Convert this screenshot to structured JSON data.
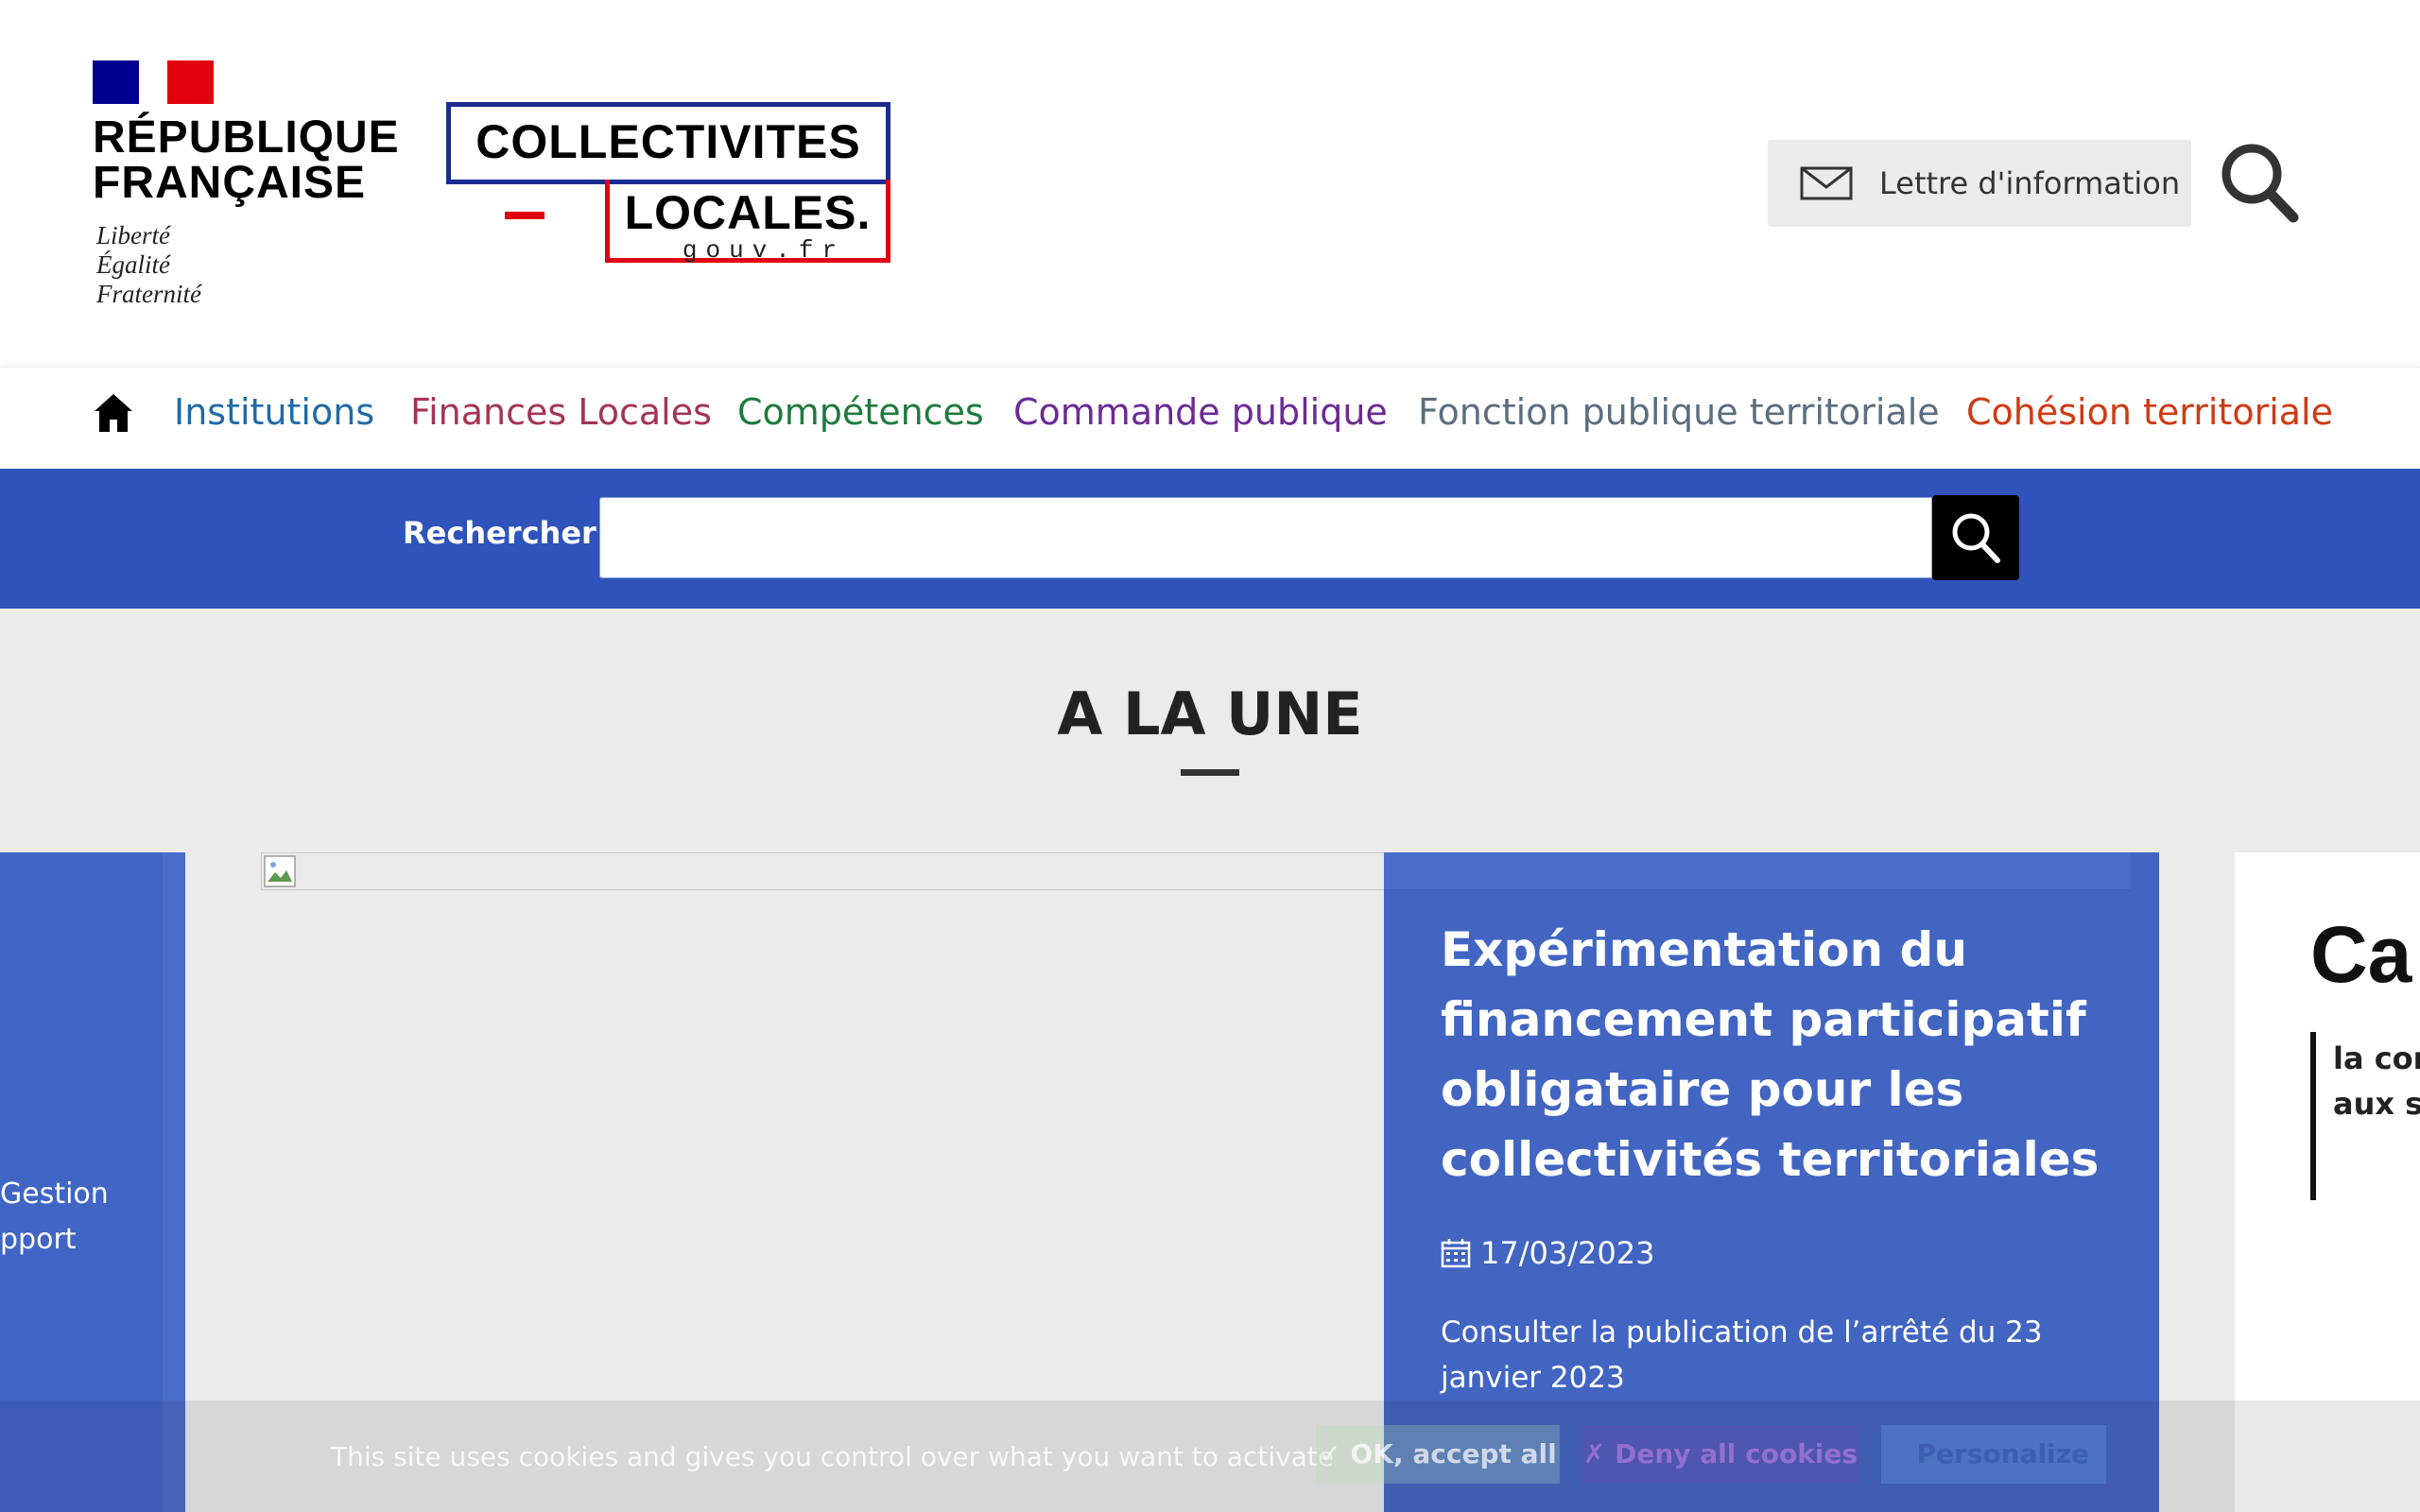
{
  "header": {
    "republique": {
      "name_line1": "RÉPUBLIQUE",
      "name_line2": "FRANÇAISE",
      "motto": [
        "Liberté",
        "Égalité",
        "Fraternité"
      ],
      "flag_colors": [
        "#000091",
        "#ffffff",
        "#e1000f"
      ]
    },
    "site_logo": {
      "line1": "COLLECTIVITES",
      "line2": "LOCALES.",
      "url": "gouv.fr",
      "colors": {
        "blue": "#1b2b8f",
        "red": "#e1000f"
      }
    },
    "newsletter_label": "Lettre d'information",
    "newsletter_icon": "envelope-icon",
    "search_icon": "search-icon"
  },
  "nav": {
    "home_icon": "home-icon",
    "items": [
      {
        "label": "Institutions",
        "color": "#1f6aa8"
      },
      {
        "label": "Finances Locales",
        "color": "#a43454"
      },
      {
        "label": "Compétences",
        "color": "#1e7a3e"
      },
      {
        "label": "Commande publique",
        "color": "#6b2a95"
      },
      {
        "label": "Fonction publique territoriale",
        "color": "#5c6d80"
      },
      {
        "label": "Cohésion territoriale",
        "color": "#cf3a12"
      }
    ]
  },
  "search": {
    "label": "Rechercher",
    "value": "",
    "band_color": "#2f53ba"
  },
  "une": {
    "title": "A LA UNE",
    "prev_slide": {
      "lines": [
        "Gestion",
        "pport"
      ]
    },
    "current_slide": {
      "headline": "Expérimentation du financement participatif obligataire pour les collectivités territoriales",
      "date": "17/03/2023",
      "description": "Consulter la publication de l’arrêté du 23 janvier 2023",
      "card_color": "#4265c2"
    },
    "next_slide": {
      "title": "Ca",
      "lines": [
        "la cor",
        "aux se"
      ]
    }
  },
  "cookies": {
    "text": "This site uses cookies and gives you control over what you want to activate",
    "accept_label": "✓ OK, accept all",
    "deny_label": "✗ Deny all cookies",
    "personalize_label": "Personalize"
  }
}
